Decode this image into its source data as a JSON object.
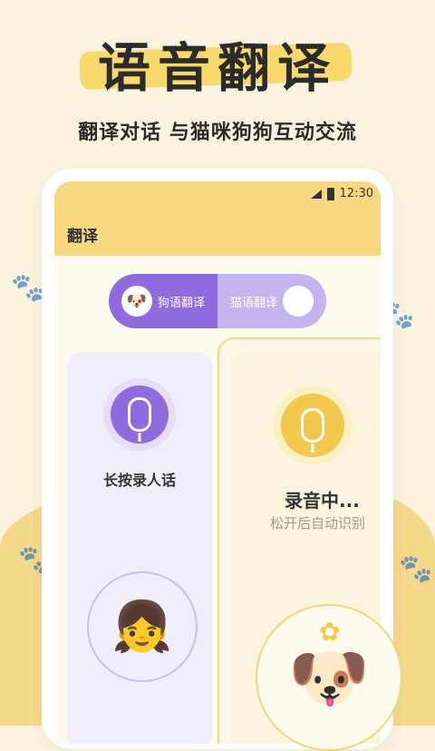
{
  "header": {
    "title": "语音翻译",
    "subtitle": "翻译对话 与猫咪狗狗互动交流"
  },
  "statusbar": {
    "time": "12:30"
  },
  "app": {
    "title": "翻译"
  },
  "toggle": {
    "dog_label": "狗语翻译",
    "cat_label": "猫语翻译"
  },
  "left_card": {
    "hint": "长按录人话"
  },
  "right_card": {
    "status": "录音中...",
    "hint": "松开后自动识别"
  },
  "colors": {
    "background": "#FBF3DD",
    "app_bar": "#F8D982",
    "purple": "#8F6BE0",
    "yellow": "#F2C94C"
  },
  "icons": {
    "dog_face": "dog-face-icon",
    "cat_face": "cat-face-icon",
    "mic": "mic-icon",
    "signal": "signal-icon",
    "battery": "battery-icon"
  }
}
